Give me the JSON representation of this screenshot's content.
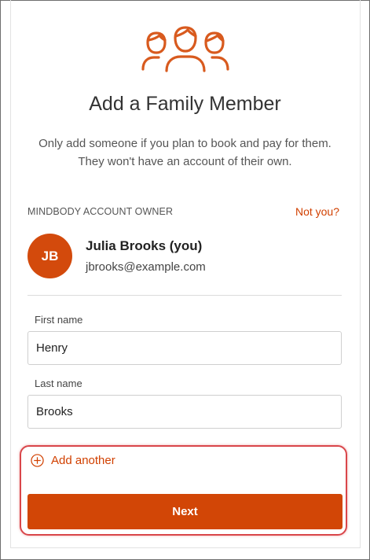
{
  "icons": {
    "family": "family-icon",
    "add": "plus-circle-icon"
  },
  "colors": {
    "accent": "#d14000",
    "button": "#d24606",
    "avatar": "#d34a0c",
    "highlight": "#d9464a"
  },
  "header": {
    "title": "Add a Family Member",
    "subtitle_line1": "Only add someone if you plan to book and pay for them.",
    "subtitle_line2": "They won't have an account of their own."
  },
  "owner": {
    "heading": "MINDBODY ACCOUNT OWNER",
    "not_you": "Not you?",
    "initials": "JB",
    "name": "Julia Brooks (you)",
    "email": "jbrooks@example.com"
  },
  "form": {
    "first_name_label": "First name",
    "first_name_value": "Henry",
    "last_name_label": "Last name",
    "last_name_value": "Brooks"
  },
  "actions": {
    "add_another": "Add another",
    "next": "Next"
  }
}
